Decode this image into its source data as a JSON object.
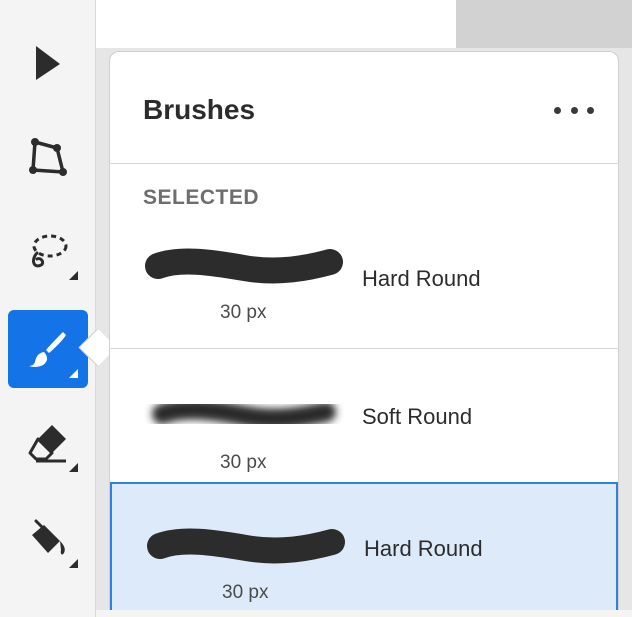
{
  "toolbar": {
    "tools": [
      {
        "name": "Select",
        "icon": "arrow-icon",
        "active": false
      },
      {
        "name": "Pen",
        "icon": "pen-path-icon",
        "active": false
      },
      {
        "name": "Lasso",
        "icon": "lasso-icon",
        "active": false
      },
      {
        "name": "Brush",
        "icon": "brush-icon",
        "active": true
      },
      {
        "name": "Eraser",
        "icon": "eraser-icon",
        "active": false
      },
      {
        "name": "Fill",
        "icon": "paint-bucket-icon",
        "active": false
      }
    ],
    "accent": "#1473e6"
  },
  "panel": {
    "title": "Brushes",
    "more_icon": "more-icon",
    "section_label": "SELECTED",
    "selected_brush": {
      "name": "Hard Round",
      "size": "30 px"
    },
    "brushes": [
      {
        "name": "Soft Round",
        "size": "30 px",
        "style": "soft"
      },
      {
        "name": "Hard Round",
        "size": "30 px",
        "style": "hard",
        "highlighted": true
      }
    ],
    "highlight_color": "#dceaf9",
    "highlight_border": "#2f81dd"
  }
}
